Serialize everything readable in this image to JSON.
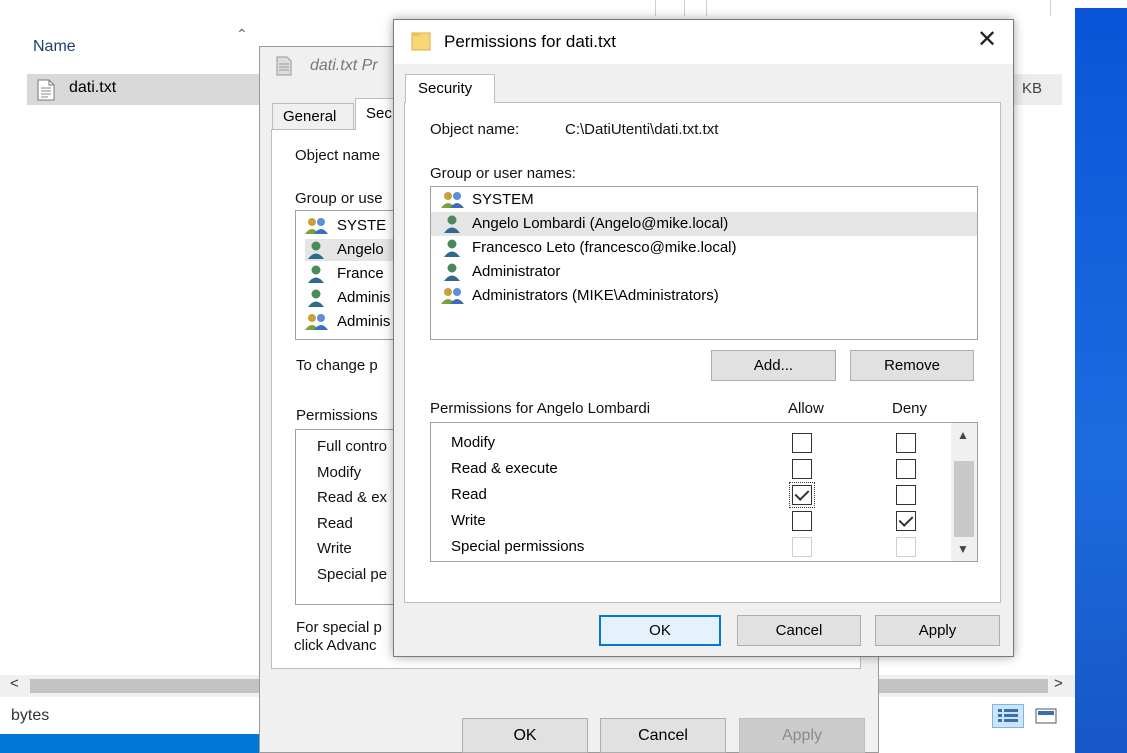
{
  "explorer": {
    "column_name": "Name",
    "file_name": "dati.txt",
    "size_unit": "KB",
    "status": "bytes",
    "icons": {
      "sort": "sort-caret-up-icon",
      "file": "text-file-icon",
      "scroll_left": "chevron-left-icon",
      "scroll_right": "chevron-right-icon",
      "details_view": "details-view-icon",
      "tiles_view": "tiles-view-icon"
    }
  },
  "properties": {
    "title": "dati.txt Pr",
    "tabs": [
      "General",
      "Sec"
    ],
    "object_name_label": "Object name",
    "group_label": "Group or use",
    "users": [
      "SYSTE",
      "Angelo",
      "France",
      "Adminis",
      "Adminis"
    ],
    "change_text": "To change p",
    "permissions_label": "Permissions",
    "permissions": [
      "Full contro",
      "Modify",
      "Read & ex",
      "Read",
      "Write",
      "Special pe"
    ],
    "special_text_1": "For special p",
    "special_text_2": "click Advanc",
    "buttons": {
      "ok": "OK",
      "cancel": "Cancel",
      "apply": "Apply"
    }
  },
  "permissions_dialog": {
    "title": "Permissions for dati.txt",
    "close_glyph": "✕",
    "tab": "Security",
    "object_name_label": "Object name:",
    "object_name_value": "C:\\DatiUtenti\\dati.txt.txt",
    "group_label": "Group or user names:",
    "users": [
      {
        "name": "SYSTEM",
        "icon": "group-icon",
        "selected": false
      },
      {
        "name": "Angelo Lombardi (Angelo@mike.local)",
        "icon": "user-icon",
        "selected": true
      },
      {
        "name": "Francesco Leto (francesco@mike.local)",
        "icon": "user-icon",
        "selected": false
      },
      {
        "name": "Administrator",
        "icon": "user-icon",
        "selected": false
      },
      {
        "name": "Administrators (MIKE\\Administrators)",
        "icon": "group-icon",
        "selected": false
      }
    ],
    "add_button": "Add...",
    "remove_button": "Remove",
    "permissions_for": "Permissions for Angelo Lombardi",
    "allow_header": "Allow",
    "deny_header": "Deny",
    "permissions": [
      {
        "name": "Modify",
        "allow": false,
        "deny": false,
        "disabled": false
      },
      {
        "name": "Read & execute",
        "allow": false,
        "deny": false,
        "disabled": false
      },
      {
        "name": "Read",
        "allow": true,
        "deny": false,
        "disabled": false
      },
      {
        "name": "Write",
        "allow": false,
        "deny": true,
        "disabled": false
      },
      {
        "name": "Special permissions",
        "allow": false,
        "deny": false,
        "disabled": true
      }
    ],
    "buttons": {
      "ok": "OK",
      "cancel": "Cancel",
      "apply": "Apply"
    },
    "scroll_up": "▲",
    "scroll_down": "▼",
    "colors": {
      "accent": "#0078d7",
      "selected_row": "#e5e5e5"
    }
  }
}
